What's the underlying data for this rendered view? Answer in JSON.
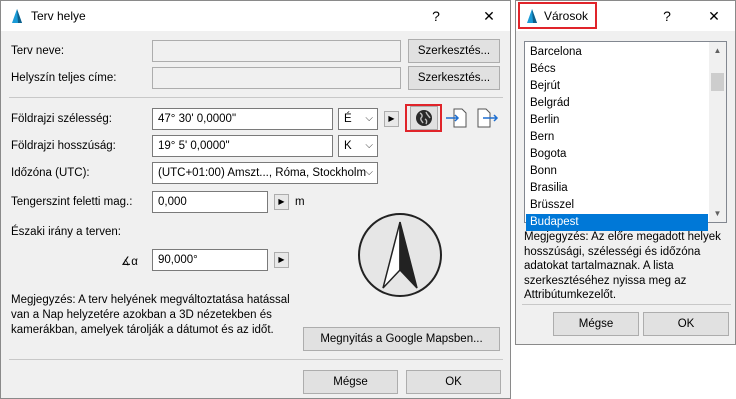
{
  "main_dialog": {
    "title": "Terv helye",
    "help_glyph": "?",
    "close_glyph": "✕",
    "plan_name_label": "Terv neve:",
    "plan_name_value": "",
    "address_label": "Helyszín teljes címe:",
    "address_value": "",
    "edit_label": "Szerkesztés...",
    "latitude_label": "Földrajzi szélesség:",
    "latitude_value": "47° 30' 0,0000\"",
    "latitude_dir": "É",
    "longitude_label": "Földrajzi hosszúság:",
    "longitude_value": "19° 5' 0,0000\"",
    "longitude_dir": "K",
    "timezone_label": "Időzóna (UTC):",
    "timezone_value": "(UTC+01:00) Amszt..., Róma, Stockholm",
    "altitude_label": "Tengerszint feletti mag.:",
    "altitude_value": "0,000",
    "altitude_unit": "m",
    "north_label": "Északi irány a terven:",
    "north_value": "90,000°",
    "angle_glyph": "∡α",
    "note": "Megjegyzés: A terv helyének megváltoztatása hatással van a Nap helyzetére azokban a 3D nézetekben és kamerákban, amelyek tárolják a dátumot és az időt.",
    "google_maps_label": "Megnyitás a Google Mapsben...",
    "cancel_label": "Mégse",
    "ok_label": "OK"
  },
  "cities_dialog": {
    "title": "Városok",
    "help_glyph": "?",
    "close_glyph": "✕",
    "cities": [
      "Barcelona",
      "Bécs",
      "Bejrút",
      "Belgrád",
      "Berlin",
      "Bern",
      "Bogota",
      "Bonn",
      "Brasilia",
      "Brüsszel",
      "Budapest"
    ],
    "selected_city": "Budapest",
    "note": "Megjegyzés: Az előre megadott helyek hosszúsági, szélességi és időzóna adatokat tartalmaznak. A lista szerkesztéséhez nyissa meg az Attribútumkezelőt.",
    "cancel_label": "Mégse",
    "ok_label": "OK"
  },
  "colors": {
    "highlight_box": "#e0242a",
    "selection": "#0078d7",
    "app_icon": "#1a9bd7"
  },
  "icons": {
    "globe": "globe-icon",
    "import_location": "import-location-icon",
    "export_location": "export-location-icon",
    "north_compass": "north-compass-icon"
  }
}
